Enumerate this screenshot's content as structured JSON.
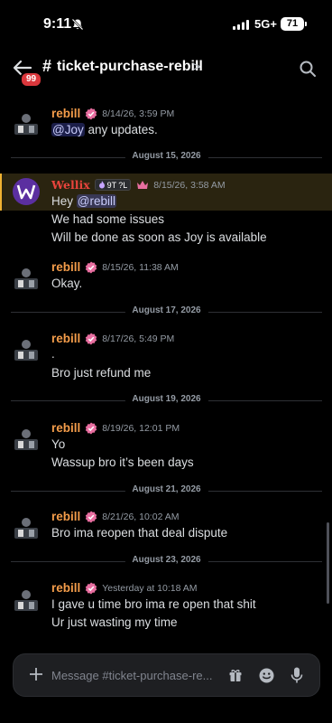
{
  "status_bar": {
    "time": "9:11",
    "network": "5G+",
    "battery": "71"
  },
  "header": {
    "back_badge": "99",
    "hash": "#",
    "channel": "ticket-purchase-rebill",
    "chevron": ">"
  },
  "messages": [
    {
      "author": "rebill",
      "timestamp": "8/14/26, 3:59 PM",
      "lines": [
        {
          "mention": "@Joy",
          "text": " any updates."
        }
      ]
    },
    {
      "divider": "August 15, 2026"
    },
    {
      "author": "Wellix",
      "tag": "9T",
      "tag_extra": "?L",
      "timestamp": "8/15/26, 3:58 AM",
      "lines": [
        {
          "text": "Hey ",
          "mention": "@rebill"
        },
        {
          "text": "We had some issues"
        },
        {
          "text": "Will be done as soon as Joy is available"
        }
      ]
    },
    {
      "author": "rebill",
      "timestamp": "8/15/26, 11:38 AM",
      "lines": [
        {
          "text": "Okay."
        }
      ]
    },
    {
      "divider": "August 17, 2026"
    },
    {
      "author": "rebill",
      "timestamp": "8/17/26, 5:49 PM",
      "lines": [
        {
          "text": "."
        },
        {
          "text": "Bro just refund me"
        }
      ]
    },
    {
      "divider": "August 19, 2026"
    },
    {
      "author": "rebill",
      "timestamp": "8/19/26, 12:01 PM",
      "lines": [
        {
          "text": "Yo"
        },
        {
          "text": "Wassup bro it’s been days"
        }
      ]
    },
    {
      "divider": "August 21, 2026"
    },
    {
      "author": "rebill",
      "timestamp": "8/21/26, 10:02 AM",
      "lines": [
        {
          "text": "Bro ima reopen that deal dispute"
        }
      ]
    },
    {
      "divider": "August 23, 2026"
    },
    {
      "author": "rebill",
      "timestamp": "Yesterday at 10:18 AM",
      "lines": [
        {
          "text": "I gave u time bro ima re open that shit"
        },
        {
          "text": "Ur just wasting my time"
        }
      ]
    }
  ],
  "composer": {
    "placeholder": "Message #ticket-purchase-re..."
  },
  "icons": {
    "back": "arrow-left-icon",
    "search": "search-icon",
    "plus": "plus-icon",
    "gift": "gift-icon",
    "emoji": "emoji-icon",
    "mic": "microphone-icon",
    "verified": "verified-badge-icon",
    "crown": "crown-icon"
  },
  "colors": {
    "author": "#f39c4a",
    "wellix": "#e8443c",
    "mention_bg": "#3c4270",
    "highlight": "#f0b232",
    "badge": "#da373c"
  }
}
